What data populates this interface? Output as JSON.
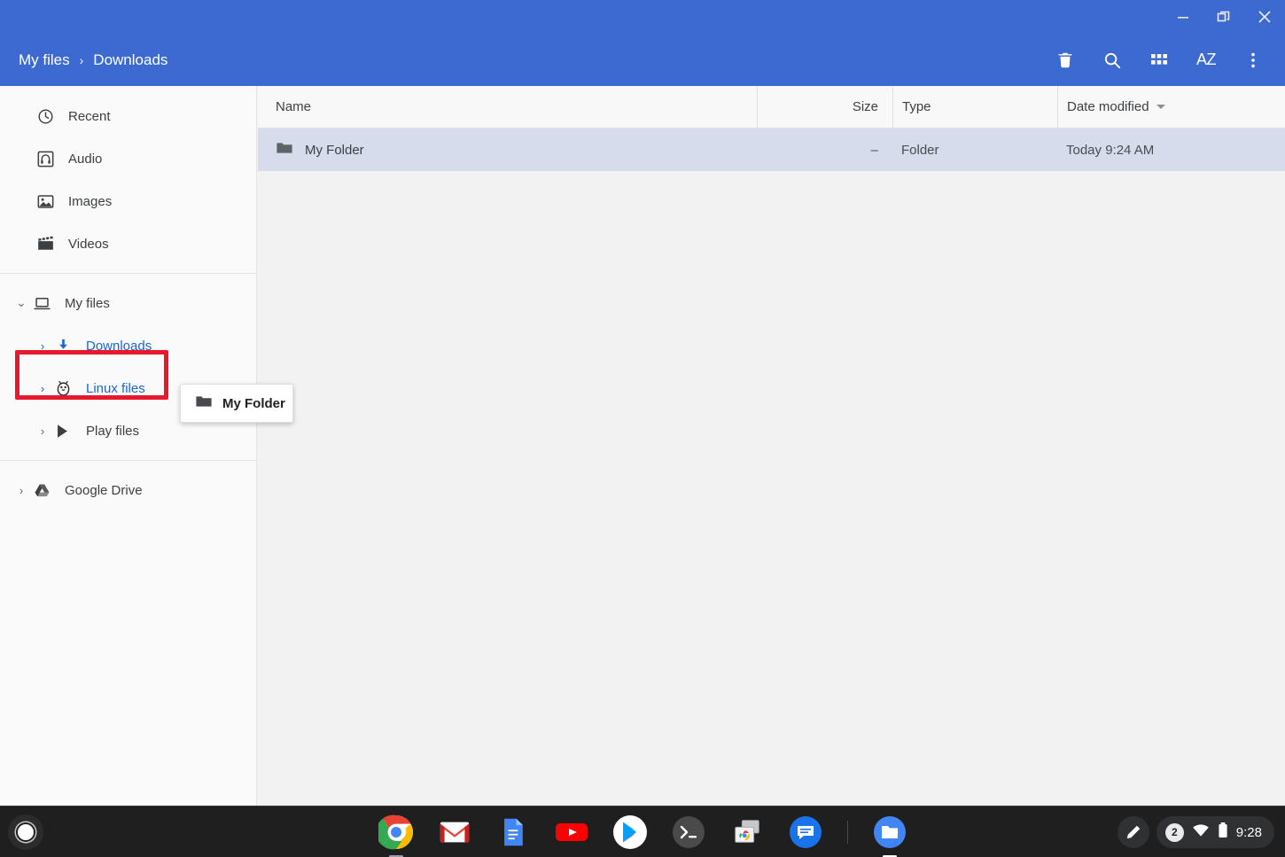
{
  "window": {
    "controls": [
      {
        "name": "minimize",
        "label": "Minimize"
      },
      {
        "name": "restore",
        "label": "Restore"
      },
      {
        "name": "close",
        "label": "Close"
      }
    ]
  },
  "header": {
    "breadcrumb": {
      "root": "My files",
      "separator": "›",
      "current": "Downloads"
    },
    "actions": [
      {
        "name": "delete",
        "label": "Delete"
      },
      {
        "name": "search",
        "label": "Search"
      },
      {
        "name": "view-grid",
        "label": "Switch to grid view"
      },
      {
        "name": "sort-az",
        "label": "AZ"
      },
      {
        "name": "more",
        "label": "More…"
      }
    ],
    "accent_color": "#3C6AD0"
  },
  "sidebar": {
    "groups": [
      {
        "items": [
          {
            "label": "Recent",
            "icon": "clock-icon",
            "indent": 0,
            "twisty": "",
            "current": false
          },
          {
            "label": "Audio",
            "icon": "audio-icon",
            "indent": 0,
            "twisty": "",
            "current": false
          },
          {
            "label": "Images",
            "icon": "image-icon",
            "indent": 0,
            "twisty": "",
            "current": false
          },
          {
            "label": "Videos",
            "icon": "video-icon",
            "indent": 0,
            "twisty": "",
            "current": false
          }
        ]
      },
      {
        "items": [
          {
            "label": "My files",
            "icon": "my-files-icon",
            "indent": 0,
            "twisty": "⌄",
            "current": false
          },
          {
            "label": "Downloads",
            "icon": "downloads-icon",
            "indent": 1,
            "twisty": "›",
            "current": true
          },
          {
            "label": "Linux files",
            "icon": "linux-icon",
            "indent": 1,
            "twisty": "›",
            "current": true
          },
          {
            "label": "Play files",
            "icon": "play-icon",
            "indent": 1,
            "twisty": "›",
            "current": false
          }
        ]
      },
      {
        "items": [
          {
            "label": "Google Drive",
            "icon": "drive-icon",
            "indent": 0,
            "twisty": "›",
            "current": false
          }
        ]
      }
    ]
  },
  "annotation": {
    "target": "Linux files",
    "color": "#E8192C"
  },
  "drag_ghost": {
    "label": "My Folder",
    "icon": "folder-icon"
  },
  "file_list": {
    "columns": [
      {
        "key": "name",
        "label": "Name",
        "sorted": false
      },
      {
        "key": "size",
        "label": "Size",
        "sorted": false
      },
      {
        "key": "type",
        "label": "Type",
        "sorted": false
      },
      {
        "key": "date",
        "label": "Date modified",
        "sorted": true,
        "direction": "desc"
      }
    ],
    "rows": [
      {
        "name": "My Folder",
        "size": "–",
        "type": "Folder",
        "date": "Today 9:24 AM",
        "icon": "folder-icon",
        "selected": true
      }
    ]
  },
  "shelf": {
    "launcher": {
      "label": "Launcher"
    },
    "apps": [
      {
        "name": "chrome",
        "label": "Chrome",
        "state": "running"
      },
      {
        "name": "gmail",
        "label": "Gmail",
        "state": ""
      },
      {
        "name": "docs",
        "label": "Docs",
        "state": ""
      },
      {
        "name": "youtube",
        "label": "YouTube",
        "state": ""
      },
      {
        "name": "play-store",
        "label": "Play Store",
        "state": ""
      },
      {
        "name": "terminal",
        "label": "Terminal",
        "state": ""
      },
      {
        "name": "screen-capture",
        "label": "Screen Capture",
        "state": ""
      },
      {
        "name": "messages",
        "label": "Messages",
        "state": ""
      },
      {
        "name": "files",
        "label": "Files",
        "state": "active"
      }
    ],
    "tray": {
      "pen": "stylus-icon",
      "notification_count": "2",
      "wifi": "wifi-icon",
      "battery": "battery-icon",
      "time": "9:28"
    }
  }
}
